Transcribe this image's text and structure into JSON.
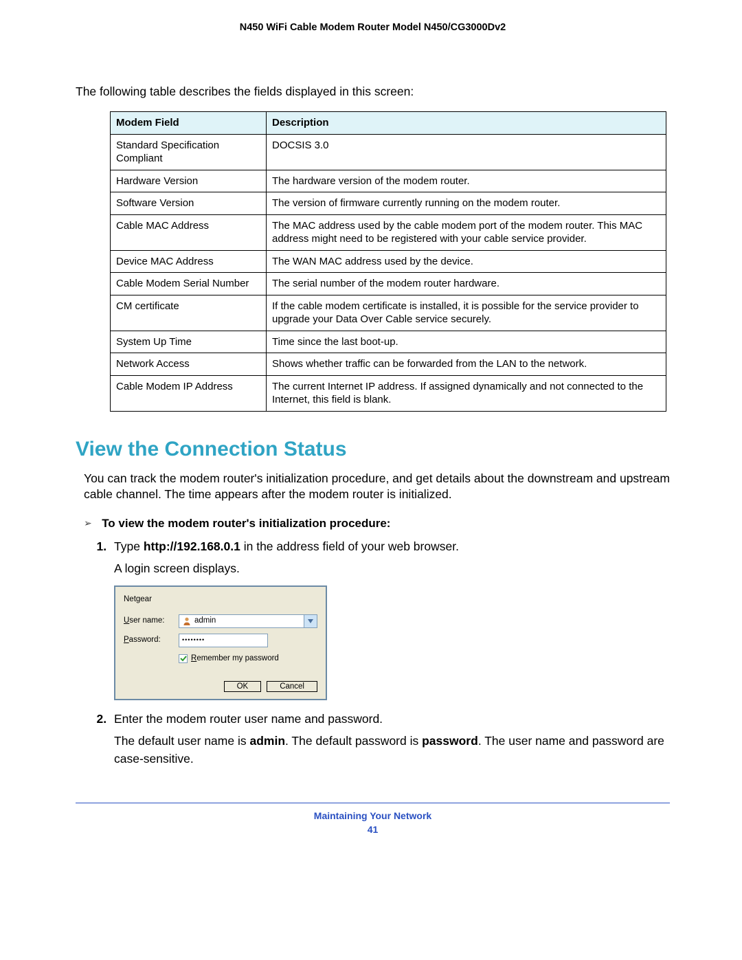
{
  "header": {
    "title": "N450 WiFi Cable Modem Router Model N450/CG3000Dv2"
  },
  "intro": "The following table describes the fields displayed in this screen:",
  "table": {
    "headers": [
      "Modem Field",
      "Description"
    ],
    "rows": [
      {
        "field": "Standard Specification Compliant",
        "desc": "DOCSIS 3.0"
      },
      {
        "field": "Hardware Version",
        "desc": "The hardware version of the modem router."
      },
      {
        "field": "Software Version",
        "desc": "The version of firmware currently running on the modem router."
      },
      {
        "field": "Cable MAC Address",
        "desc": "The MAC address used by the cable modem port of the modem router. This MAC address might need to be registered with your cable service provider."
      },
      {
        "field": "Device MAC Address",
        "desc": "The WAN MAC address used by the device."
      },
      {
        "field": "Cable Modem Serial Number",
        "desc": "The serial number of the modem router hardware."
      },
      {
        "field": "CM certificate",
        "desc": "If the cable modem certificate is installed, it is possible for the service provider to upgrade your Data Over Cable service securely."
      },
      {
        "field": "System Up Time",
        "desc": "Time since the last boot-up."
      },
      {
        "field": "Network Access",
        "desc": "Shows whether traffic can be forwarded from the LAN to the network."
      },
      {
        "field": "Cable Modem IP Address",
        "desc": "The current Internet IP address. If assigned dynamically and not connected to the Internet, this field is blank."
      }
    ]
  },
  "section": {
    "title": "View the Connection Status",
    "body": "You can track the modem router's initialization procedure, and get details about the downstream and upstream cable channel. The time appears after the modem router is initialized.",
    "procedure_title": "To view the modem router's initialization procedure:",
    "steps": {
      "s1_pre": "Type ",
      "s1_bold": "http://192.168.0.1",
      "s1_post": " in the address field of your web browser.",
      "s1_sub": "A login screen displays.",
      "s2": "Enter the modem router user name and password.",
      "s2_sub_a": "The default user name is ",
      "s2_sub_b": "admin",
      "s2_sub_c": ". The default password is ",
      "s2_sub_d": "password",
      "s2_sub_e": ". The user name and password are case-sensitive."
    }
  },
  "login": {
    "realm": "Netgear",
    "username_label_pre": "U",
    "username_label_post": "ser name:",
    "password_label_pre": "P",
    "password_label_post": "assword:",
    "username_value": "admin",
    "password_masked": "••••••••",
    "remember_pre": "R",
    "remember_post": "emember my password",
    "ok": "OK",
    "cancel": "Cancel"
  },
  "footer": {
    "section": "Maintaining Your Network",
    "page": "41"
  }
}
